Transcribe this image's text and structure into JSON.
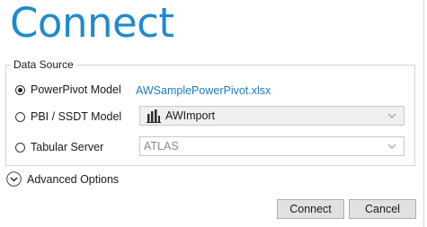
{
  "dialog": {
    "title": "Connect"
  },
  "data_source": {
    "legend": "Data Source",
    "options": [
      {
        "label": "PowerPivot Model",
        "selected": true
      },
      {
        "label": "PBI / SSDT Model",
        "selected": false
      },
      {
        "label": "Tabular Server",
        "selected": false
      }
    ],
    "powerpivot_file": "AWSamplePowerPivot.xlsx",
    "model_select": {
      "value": "AWImport",
      "icon": "powerbi-model-icon",
      "enabled": false
    },
    "server_select": {
      "value": "ATLAS",
      "enabled": false
    }
  },
  "advanced": {
    "label": "Advanced Options",
    "icon": "chevron-down-circle-icon"
  },
  "buttons": {
    "connect": "Connect",
    "cancel": "Cancel"
  },
  "colors": {
    "accent": "#1e8bcd",
    "link": "#1e7bc1"
  }
}
